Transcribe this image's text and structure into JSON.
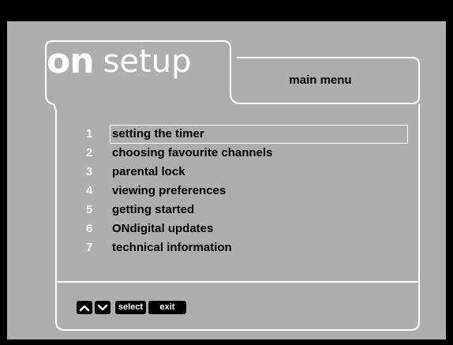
{
  "header": {
    "logo_on": "on",
    "logo_setup": "setup",
    "title": "main menu"
  },
  "menu": {
    "selected_index": 0,
    "items": [
      {
        "number": "1",
        "label": "setting the timer"
      },
      {
        "number": "2",
        "label": "choosing favourite channels"
      },
      {
        "number": "3",
        "label": "parental lock"
      },
      {
        "number": "4",
        "label": "viewing preferences"
      },
      {
        "number": "5",
        "label": "getting started"
      },
      {
        "number": "6",
        "label": "ONdigital updates"
      },
      {
        "number": "7",
        "label": "technical information"
      }
    ]
  },
  "controls": {
    "up_icon": "chevron-up-icon",
    "down_icon": "chevron-down-icon",
    "select_label": "select",
    "exit_label": "exit"
  },
  "colors": {
    "background": "#000000",
    "panel": "#aeaeae",
    "outline": "#ffffff",
    "number": "#f2f2f2",
    "text": "#000000"
  }
}
